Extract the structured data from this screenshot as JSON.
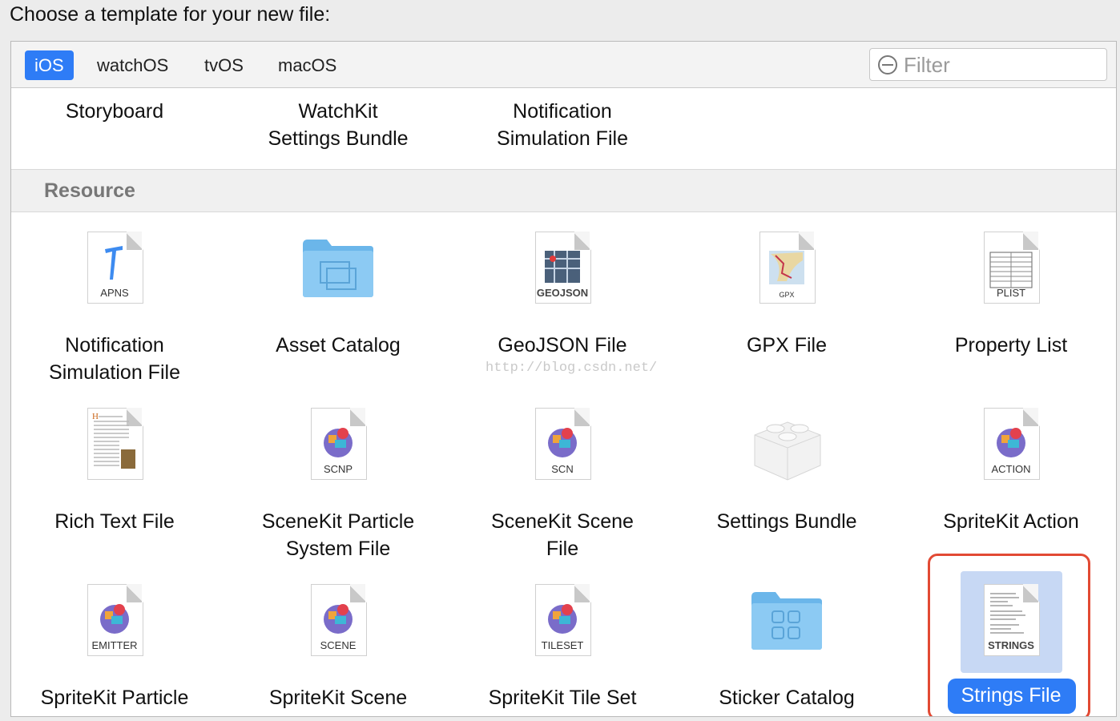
{
  "header": {
    "prompt": "Choose a template for your new file:"
  },
  "tabs": [
    "iOS",
    "watchOS",
    "tvOS",
    "macOS"
  ],
  "filter": {
    "placeholder": "Filter"
  },
  "top_row": [
    {
      "line1": "Storyboard",
      "line2": ""
    },
    {
      "line1": "WatchKit",
      "line2": "Settings Bundle"
    },
    {
      "line1": "Notification",
      "line2": "Simulation File"
    }
  ],
  "section": {
    "title": "Resource"
  },
  "items": [
    {
      "line1": "Notification",
      "line2": "Simulation File",
      "icon": "apns-file-icon",
      "tag": "APNS"
    },
    {
      "line1": "Asset Catalog",
      "line2": "",
      "icon": "folder-icon",
      "tag": ""
    },
    {
      "line1": "GeoJSON File",
      "line2": "",
      "icon": "geojson-file-icon",
      "tag": "GEOJSON"
    },
    {
      "line1": "GPX File",
      "line2": "",
      "icon": "gpx-file-icon",
      "tag": "GPX"
    },
    {
      "line1": "Property List",
      "line2": "",
      "icon": "plist-file-icon",
      "tag": "PLIST"
    },
    {
      "line1": "Rich Text File",
      "line2": "",
      "icon": "rich-text-file-icon",
      "tag": ""
    },
    {
      "line1": "SceneKit Particle",
      "line2": "System File",
      "icon": "scnp-file-icon",
      "tag": "SCNP"
    },
    {
      "line1": "SceneKit Scene",
      "line2": "File",
      "icon": "scn-file-icon",
      "tag": "SCN"
    },
    {
      "line1": "Settings Bundle",
      "line2": "",
      "icon": "lego-brick-icon",
      "tag": ""
    },
    {
      "line1": "SpriteKit Action",
      "line2": "",
      "icon": "action-file-icon",
      "tag": "ACTION"
    },
    {
      "line1": "SpriteKit Particle",
      "line2": "",
      "icon": "emitter-file-icon",
      "tag": "EMITTER"
    },
    {
      "line1": "SpriteKit Scene",
      "line2": "",
      "icon": "scene-file-icon",
      "tag": "SCENE"
    },
    {
      "line1": "SpriteKit Tile Set",
      "line2": "",
      "icon": "tileset-file-icon",
      "tag": "TILESET"
    },
    {
      "line1": "Sticker Catalog",
      "line2": "",
      "icon": "sticker-folder-icon",
      "tag": ""
    },
    {
      "line1": "Strings File",
      "line2": "",
      "icon": "strings-file-icon",
      "tag": "STRINGS",
      "selected": true
    }
  ],
  "watermark": "http://blog.csdn.net/",
  "colors": {
    "accent": "#2e7cf6",
    "highlight_border": "#e24a34",
    "selection_fill": "#c7d8f4"
  }
}
